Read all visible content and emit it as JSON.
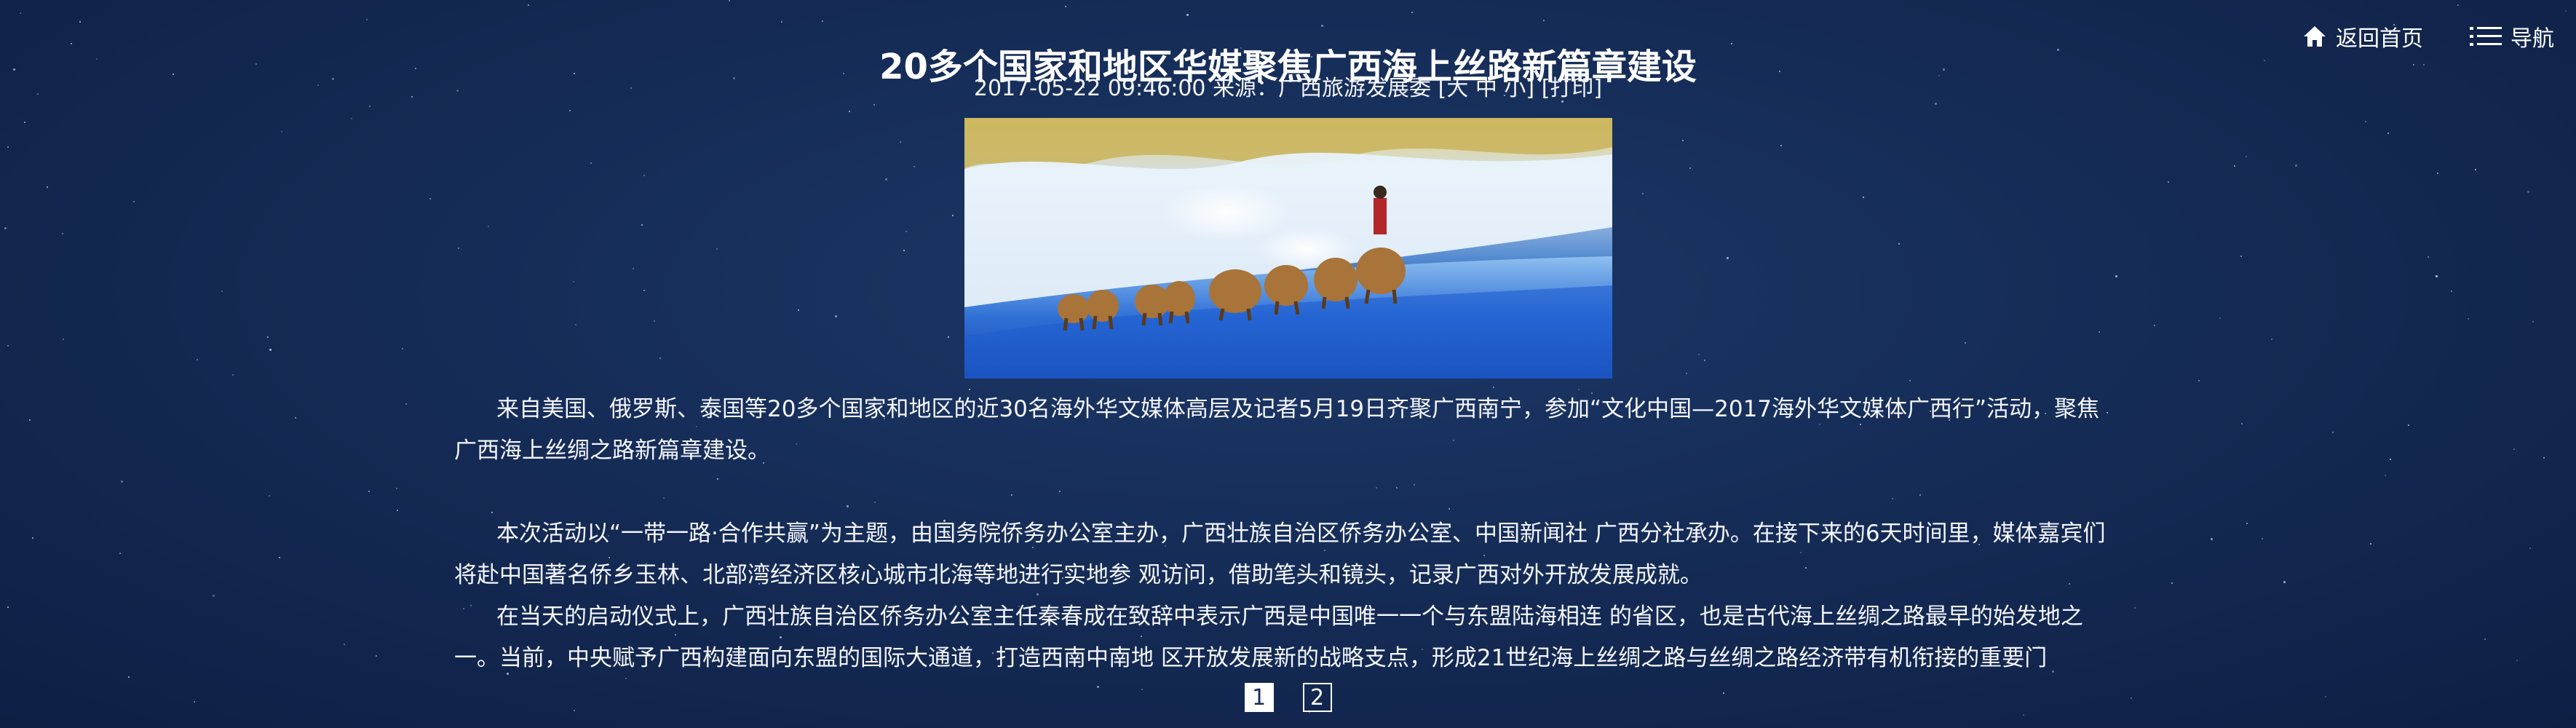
{
  "nav": {
    "home_label": "返回首页",
    "menu_label": "导航"
  },
  "article": {
    "title": "20多个国家和地区华媒聚焦广西海上丝路新篇章建设",
    "datetime": "2017-05-22 09:46:00",
    "source_prefix": "来源：",
    "source": "广西旅游发展委",
    "font_size_open": "[",
    "font_large": "大",
    "font_medium": "中",
    "font_small": "小",
    "font_size_close": "]",
    "print": "[打印]",
    "paragraphs": [
      "来自美国、俄罗斯、泰国等20多个国家和地区的近30名海外华文媒体高层及记者5月19日齐聚广西南宁，参加“文化中国—2017海外华文媒体广西行”活动，聚焦广西海上丝绸之路新篇章建设。",
      "本次活动以“一带一路·合作共赢”为主题，由国务院侨务办公室主办，广西壮族自治区侨务办公室、中国新闻社 广西分社承办。在接下来的6天时间里，媒体嘉宾们将赴中国著名侨乡玉林、北部湾经济区核心城市北海等地进行实地参 观访问，借助笔头和镜头，记录广西对外开放发展成就。",
      "在当天的启动仪式上，广西壮族自治区侨务办公室主任秦春成在致辞中表示广西是中国唯一一个与东盟陆海相连 的省区，也是古代海上丝绸之路最早的始发地之一。当前，中央赋予广西构建面向东盟的国际大通道，打造西南中南地 区开放发展新的战略支点，形成21世纪海上丝绸之路与丝绸之路经济带有机衔接的重要门"
    ]
  },
  "pager": {
    "pages": [
      "1",
      "2"
    ],
    "current": "1"
  },
  "colors": {
    "background": "#152c57",
    "text": "#ffffff"
  }
}
